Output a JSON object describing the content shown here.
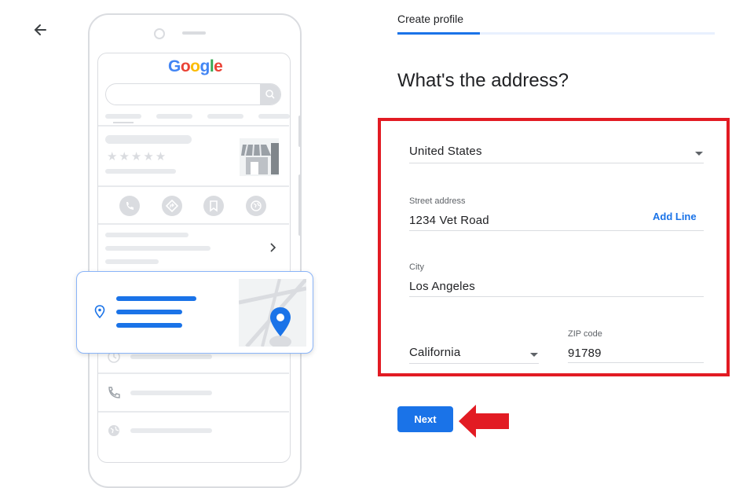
{
  "header": {
    "tab_label": "Create profile",
    "progress": 0.26
  },
  "page": {
    "title": "What's the address?"
  },
  "illustration": {
    "brand_text": "Google",
    "stars": "★★★★★"
  },
  "form": {
    "country": {
      "value": "United States"
    },
    "street": {
      "label": "Street address",
      "value": "1234 Vet Road",
      "add_line": "Add Line"
    },
    "city": {
      "label": "City",
      "value": "Los Angeles"
    },
    "state": {
      "value": "California"
    },
    "zip": {
      "label": "ZIP code",
      "value": "91789"
    }
  },
  "actions": {
    "next_label": "Next"
  },
  "colors": {
    "accent": "#1a73e8",
    "highlight": "#e21b23",
    "muted": "#dadce0"
  },
  "icons": [
    "arrow-back-icon",
    "search-icon",
    "storefront-icon",
    "phone-icon",
    "directions-icon",
    "bookmark-icon",
    "globe-icon",
    "chevron-right-icon",
    "location-pin-icon",
    "map-pin-icon",
    "clock-icon",
    "dropdown-arrow-icon",
    "red-arrow-icon"
  ]
}
